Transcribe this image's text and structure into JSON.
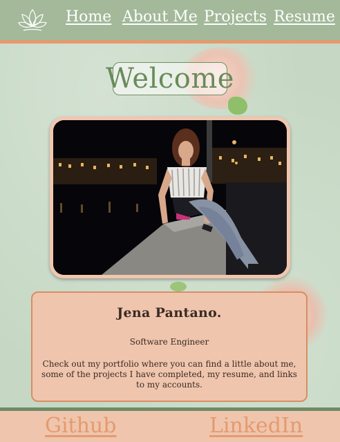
{
  "nav": {
    "items": [
      {
        "label": "Home"
      },
      {
        "label": "About Me"
      },
      {
        "label": "Projects"
      },
      {
        "label": "Resume"
      }
    ]
  },
  "hero": {
    "title": "Welcome"
  },
  "profile": {
    "name": "Jena Pantano.",
    "role": "Software Engineer",
    "description": "Check out my portfolio where you can find a little about me, some of the projects I have completed, my resume, and links to my accounts."
  },
  "footer": {
    "links": [
      {
        "label": "Github"
      },
      {
        "label": "LinkedIn"
      }
    ]
  },
  "colors": {
    "header_bg": "#a3b99a",
    "accent_orange": "#e49a6f",
    "card_bg": "#efc5ad",
    "page_green": "#c6d8c4"
  }
}
